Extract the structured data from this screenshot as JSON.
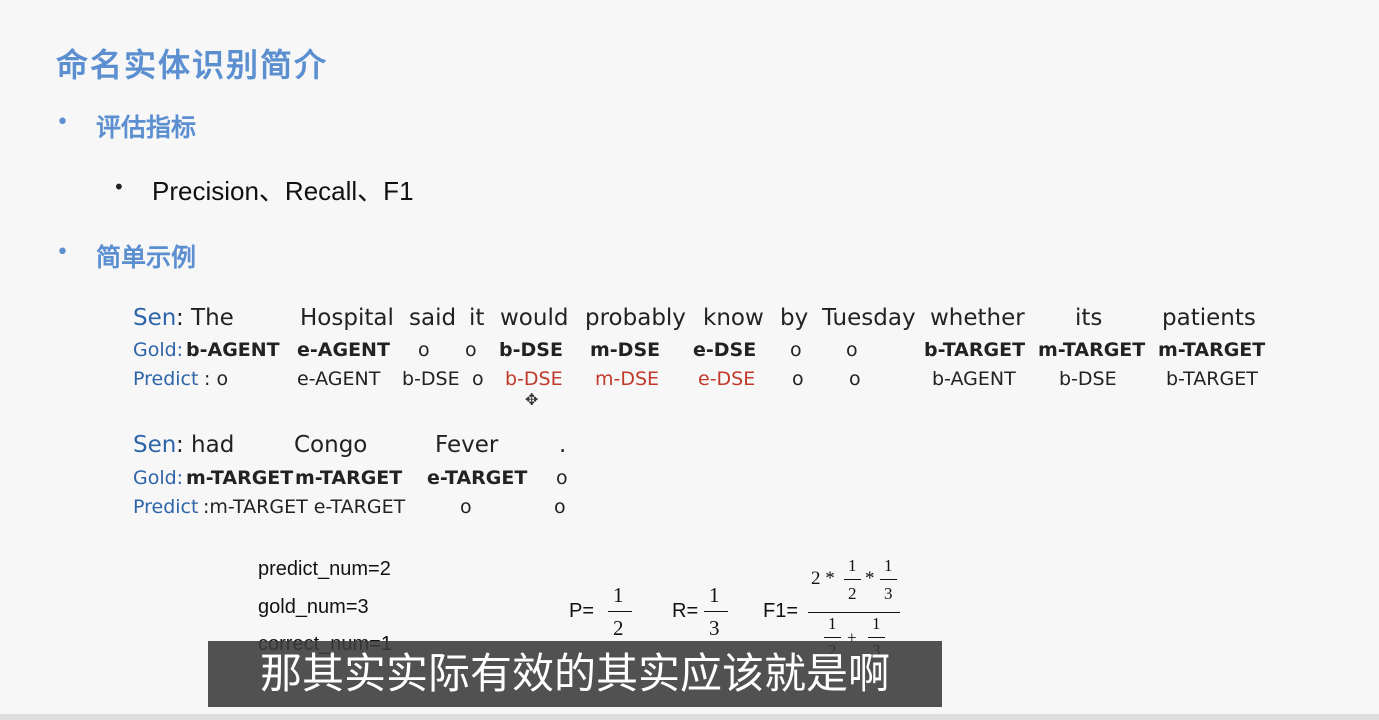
{
  "slide": {
    "title": "命名实体识别简介",
    "bullets": [
      {
        "label": "评估指标"
      },
      {
        "label": "简单示例"
      }
    ],
    "metrics": "Precision、Recall、F1"
  },
  "example1": {
    "sen_label": "Sen",
    "sen_words": [
      ": The",
      "Hospital",
      "said",
      "it",
      "would",
      "probably",
      "know",
      "by",
      "Tuesday",
      "whether",
      "its",
      "patients"
    ],
    "gold_label": "Gold:",
    "gold_tags": [
      "b-AGENT",
      "e-AGENT",
      "o",
      "o",
      "b-DSE",
      "m-DSE",
      "e-DSE",
      "o",
      "o",
      "b-TARGET",
      "m-TARGET",
      "m-TARGET"
    ],
    "predict_label": "Predict",
    "predict_tags": [
      ": o",
      "e-AGENT",
      "b-DSE",
      "o",
      "b-DSE",
      "m-DSE",
      "e-DSE",
      "o",
      "o",
      "b-AGENT",
      "b-DSE",
      "b-TARGET"
    ]
  },
  "example2": {
    "sen_label": "Sen",
    "sen_words": [
      ": had",
      "Congo",
      "Fever",
      "."
    ],
    "gold_label": "Gold:",
    "gold_tags": [
      "m-TARGET",
      "m-TARGET",
      "e-TARGET",
      "o"
    ],
    "predict_label": "Predict",
    "predict_tags": [
      ":m-TARGET e-TARGET",
      "o",
      "o"
    ]
  },
  "calc": {
    "predict_num": "predict_num=2",
    "gold_num": "gold_num=3",
    "correct_num": "correct_num=1",
    "p_label": "P=",
    "p_num": "1",
    "p_den": "2",
    "r_label": "R=",
    "r_num": "1",
    "r_den": "3",
    "f1_label": "F1=",
    "f1_top_prefix": "2 *",
    "f1_top_mid": "*",
    "f1_top_a_num": "1",
    "f1_top_a_den": "2",
    "f1_top_b_num": "1",
    "f1_top_b_den": "3",
    "f1_bot_a_num": "1",
    "f1_bot_a_den": "2",
    "f1_bot_plus": "+",
    "f1_bot_b_num": "1",
    "f1_bot_b_den": "3"
  },
  "subtitle": "那其实实际有效的其实应该就是啊",
  "colors": {
    "title": "#5b8fd0",
    "label_blue": "#2e64a8",
    "mismatch_red": "#c0392b"
  }
}
